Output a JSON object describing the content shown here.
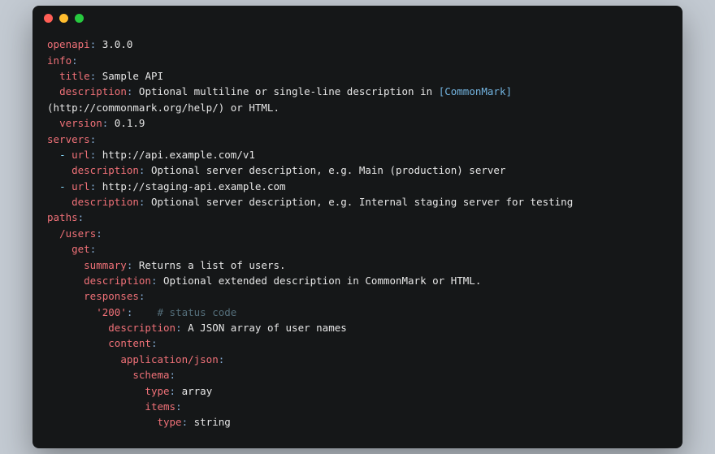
{
  "lines": [
    {
      "indent": 0,
      "tokens": [
        {
          "t": "openapi",
          "c": "k"
        },
        {
          "t": ":",
          "c": "p"
        },
        {
          "t": " 3.0.0",
          "c": "v"
        }
      ]
    },
    {
      "indent": 0,
      "tokens": [
        {
          "t": "info",
          "c": "k"
        },
        {
          "t": ":",
          "c": "p"
        }
      ]
    },
    {
      "indent": 1,
      "tokens": [
        {
          "t": "title",
          "c": "k"
        },
        {
          "t": ":",
          "c": "p"
        },
        {
          "t": " Sample API",
          "c": "v"
        }
      ]
    },
    {
      "indent": 1,
      "tokens": [
        {
          "t": "description",
          "c": "k"
        },
        {
          "t": ":",
          "c": "p"
        },
        {
          "t": " Optional multiline or single-line description in ",
          "c": "v"
        },
        {
          "t": "[CommonMark]",
          "c": "b"
        }
      ]
    },
    {
      "indent": 0,
      "tokens": [
        {
          "t": "(http://commonmark.org/help/) or HTML.",
          "c": "v"
        }
      ]
    },
    {
      "indent": 1,
      "tokens": [
        {
          "t": "version",
          "c": "k"
        },
        {
          "t": ":",
          "c": "p"
        },
        {
          "t": " 0.1.9",
          "c": "v"
        }
      ]
    },
    {
      "indent": 0,
      "tokens": [
        {
          "t": "servers",
          "c": "k"
        },
        {
          "t": ":",
          "c": "p"
        }
      ]
    },
    {
      "indent": 1,
      "tokens": [
        {
          "t": "- ",
          "c": "d"
        },
        {
          "t": "url",
          "c": "k"
        },
        {
          "t": ":",
          "c": "p"
        },
        {
          "t": " http://api.example.com/v1",
          "c": "v"
        }
      ]
    },
    {
      "indent": 2,
      "tokens": [
        {
          "t": "description",
          "c": "k"
        },
        {
          "t": ":",
          "c": "p"
        },
        {
          "t": " Optional server description, e.g. Main (production) server",
          "c": "v"
        }
      ]
    },
    {
      "indent": 1,
      "tokens": [
        {
          "t": "- ",
          "c": "d"
        },
        {
          "t": "url",
          "c": "k"
        },
        {
          "t": ":",
          "c": "p"
        },
        {
          "t": " http://staging-api.example.com",
          "c": "v"
        }
      ]
    },
    {
      "indent": 2,
      "tokens": [
        {
          "t": "description",
          "c": "k"
        },
        {
          "t": ":",
          "c": "p"
        },
        {
          "t": " Optional server description, e.g. Internal staging server for testing",
          "c": "v"
        }
      ]
    },
    {
      "indent": 0,
      "tokens": [
        {
          "t": "paths",
          "c": "k"
        },
        {
          "t": ":",
          "c": "p"
        }
      ]
    },
    {
      "indent": 1,
      "tokens": [
        {
          "t": "/users",
          "c": "k"
        },
        {
          "t": ":",
          "c": "p"
        }
      ]
    },
    {
      "indent": 2,
      "tokens": [
        {
          "t": "get",
          "c": "k"
        },
        {
          "t": ":",
          "c": "p"
        }
      ]
    },
    {
      "indent": 3,
      "tokens": [
        {
          "t": "summary",
          "c": "k"
        },
        {
          "t": ":",
          "c": "p"
        },
        {
          "t": " Returns a list of users.",
          "c": "v"
        }
      ]
    },
    {
      "indent": 3,
      "tokens": [
        {
          "t": "description",
          "c": "k"
        },
        {
          "t": ":",
          "c": "p"
        },
        {
          "t": " Optional extended description in CommonMark or HTML.",
          "c": "v"
        }
      ]
    },
    {
      "indent": 3,
      "tokens": [
        {
          "t": "responses",
          "c": "k"
        },
        {
          "t": ":",
          "c": "p"
        }
      ]
    },
    {
      "indent": 4,
      "tokens": [
        {
          "t": "'200'",
          "c": "k"
        },
        {
          "t": ":",
          "c": "p"
        },
        {
          "t": "    # status code",
          "c": "c"
        }
      ]
    },
    {
      "indent": 5,
      "tokens": [
        {
          "t": "description",
          "c": "k"
        },
        {
          "t": ":",
          "c": "p"
        },
        {
          "t": " A JSON array of user names",
          "c": "v"
        }
      ]
    },
    {
      "indent": 5,
      "tokens": [
        {
          "t": "content",
          "c": "k"
        },
        {
          "t": ":",
          "c": "p"
        }
      ]
    },
    {
      "indent": 6,
      "tokens": [
        {
          "t": "application/json",
          "c": "k"
        },
        {
          "t": ":",
          "c": "p"
        }
      ]
    },
    {
      "indent": 7,
      "tokens": [
        {
          "t": "schema",
          "c": "k"
        },
        {
          "t": ":",
          "c": "p"
        }
      ]
    },
    {
      "indent": 8,
      "tokens": [
        {
          "t": "type",
          "c": "k"
        },
        {
          "t": ":",
          "c": "p"
        },
        {
          "t": " array",
          "c": "v"
        }
      ]
    },
    {
      "indent": 8,
      "tokens": [
        {
          "t": "items",
          "c": "k"
        },
        {
          "t": ":",
          "c": "p"
        }
      ]
    },
    {
      "indent": 9,
      "tokens": [
        {
          "t": "type",
          "c": "k"
        },
        {
          "t": ":",
          "c": "p"
        },
        {
          "t": " string",
          "c": "v"
        }
      ]
    }
  ]
}
